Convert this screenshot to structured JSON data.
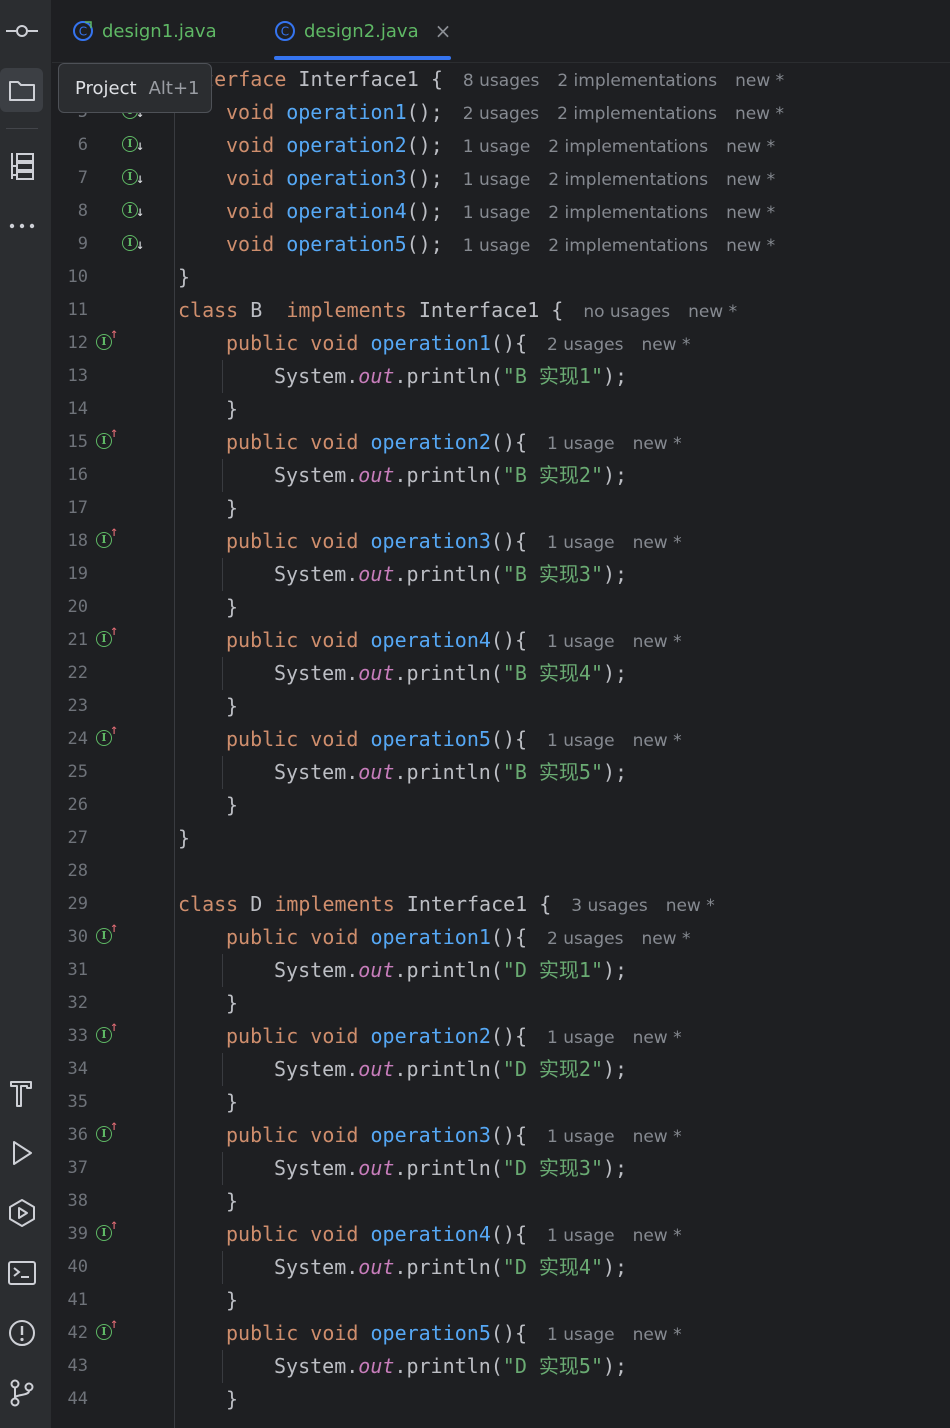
{
  "tabs": [
    {
      "label": "design1.java",
      "active": false
    },
    {
      "label": "design2.java",
      "active": true
    }
  ],
  "tooltip": {
    "label": "Project",
    "shortcut": "Alt+1"
  },
  "sidebar": {
    "top": [
      "commit-icon",
      "folder-icon",
      "structure-icon",
      "more-icon"
    ],
    "bottom": [
      "build-icon",
      "run-icon",
      "services-icon",
      "terminal-icon",
      "problems-icon",
      "git-icon"
    ]
  },
  "lines": [
    {
      "n": "",
      "gutter": "",
      "indent": 0,
      "tokens": [
        [
          "kw",
          "interface "
        ],
        [
          "plain",
          "Interface1 {"
        ]
      ],
      "hints": [
        "8 usages",
        "2 implementations",
        "new *"
      ]
    },
    {
      "n": "5",
      "gutter": "impl",
      "indent": 1,
      "tokens": [
        [
          "kw",
          "void "
        ],
        [
          "fn",
          "operation1"
        ],
        [
          "plain",
          "();"
        ]
      ],
      "hints": [
        "2 usages",
        "2 implementations",
        "new *"
      ]
    },
    {
      "n": "6",
      "gutter": "impl",
      "indent": 1,
      "tokens": [
        [
          "kw",
          "void "
        ],
        [
          "fn",
          "operation2"
        ],
        [
          "plain",
          "();"
        ]
      ],
      "hints": [
        "1 usage",
        "2 implementations",
        "new *"
      ]
    },
    {
      "n": "7",
      "gutter": "impl",
      "indent": 1,
      "tokens": [
        [
          "kw",
          "void "
        ],
        [
          "fn",
          "operation3"
        ],
        [
          "plain",
          "();"
        ]
      ],
      "hints": [
        "1 usage",
        "2 implementations",
        "new *"
      ]
    },
    {
      "n": "8",
      "gutter": "impl",
      "indent": 1,
      "tokens": [
        [
          "kw",
          "void "
        ],
        [
          "fn",
          "operation4"
        ],
        [
          "plain",
          "();"
        ]
      ],
      "hints": [
        "1 usage",
        "2 implementations",
        "new *"
      ]
    },
    {
      "n": "9",
      "gutter": "impl",
      "indent": 1,
      "tokens": [
        [
          "kw",
          "void "
        ],
        [
          "fn",
          "operation5"
        ],
        [
          "plain",
          "();"
        ]
      ],
      "hints": [
        "1 usage",
        "2 implementations",
        "new *"
      ]
    },
    {
      "n": "10",
      "gutter": "",
      "indent": 0,
      "tokens": [
        [
          "plain",
          "}"
        ]
      ],
      "hints": []
    },
    {
      "n": "11",
      "gutter": "",
      "indent": 0,
      "tokens": [
        [
          "kw",
          "class "
        ],
        [
          "plain",
          "B  "
        ],
        [
          "kw",
          "implements "
        ],
        [
          "plain",
          "Interface1 {"
        ]
      ],
      "hints": [
        "no usages",
        "new *"
      ]
    },
    {
      "n": "12",
      "gutter": "over",
      "indent": 1,
      "tokens": [
        [
          "kw",
          "public void "
        ],
        [
          "fn",
          "operation1"
        ],
        [
          "plain",
          "(){"
        ]
      ],
      "hints": [
        "2 usages",
        "new *"
      ]
    },
    {
      "n": "13",
      "gutter": "",
      "indent": 2,
      "tokens": [
        [
          "plain",
          "System."
        ],
        [
          "fld",
          "out"
        ],
        [
          "plain",
          ".println("
        ],
        [
          "str",
          "\"B 实现1\""
        ],
        [
          "plain",
          ");"
        ]
      ],
      "hints": []
    },
    {
      "n": "14",
      "gutter": "",
      "indent": 1,
      "tokens": [
        [
          "plain",
          "}"
        ]
      ],
      "hints": []
    },
    {
      "n": "15",
      "gutter": "over",
      "indent": 1,
      "tokens": [
        [
          "kw",
          "public void "
        ],
        [
          "fn",
          "operation2"
        ],
        [
          "plain",
          "(){"
        ]
      ],
      "hints": [
        "1 usage",
        "new *"
      ]
    },
    {
      "n": "16",
      "gutter": "",
      "indent": 2,
      "tokens": [
        [
          "plain",
          "System."
        ],
        [
          "fld",
          "out"
        ],
        [
          "plain",
          ".println("
        ],
        [
          "str",
          "\"B 实现2\""
        ],
        [
          "plain",
          ");"
        ]
      ],
      "hints": []
    },
    {
      "n": "17",
      "gutter": "",
      "indent": 1,
      "tokens": [
        [
          "plain",
          "}"
        ]
      ],
      "hints": []
    },
    {
      "n": "18",
      "gutter": "over",
      "indent": 1,
      "tokens": [
        [
          "kw",
          "public void "
        ],
        [
          "fn",
          "operation3"
        ],
        [
          "plain",
          "(){"
        ]
      ],
      "hints": [
        "1 usage",
        "new *"
      ]
    },
    {
      "n": "19",
      "gutter": "",
      "indent": 2,
      "tokens": [
        [
          "plain",
          "System."
        ],
        [
          "fld",
          "out"
        ],
        [
          "plain",
          ".println("
        ],
        [
          "str",
          "\"B 实现3\""
        ],
        [
          "plain",
          ");"
        ]
      ],
      "hints": []
    },
    {
      "n": "20",
      "gutter": "",
      "indent": 1,
      "tokens": [
        [
          "plain",
          "}"
        ]
      ],
      "hints": []
    },
    {
      "n": "21",
      "gutter": "over",
      "indent": 1,
      "tokens": [
        [
          "kw",
          "public void "
        ],
        [
          "fn",
          "operation4"
        ],
        [
          "plain",
          "(){"
        ]
      ],
      "hints": [
        "1 usage",
        "new *"
      ]
    },
    {
      "n": "22",
      "gutter": "",
      "indent": 2,
      "tokens": [
        [
          "plain",
          "System."
        ],
        [
          "fld",
          "out"
        ],
        [
          "plain",
          ".println("
        ],
        [
          "str",
          "\"B 实现4\""
        ],
        [
          "plain",
          ");"
        ]
      ],
      "hints": []
    },
    {
      "n": "23",
      "gutter": "",
      "indent": 1,
      "tokens": [
        [
          "plain",
          "}"
        ]
      ],
      "hints": []
    },
    {
      "n": "24",
      "gutter": "over",
      "indent": 1,
      "tokens": [
        [
          "kw",
          "public void "
        ],
        [
          "fn",
          "operation5"
        ],
        [
          "plain",
          "(){"
        ]
      ],
      "hints": [
        "1 usage",
        "new *"
      ]
    },
    {
      "n": "25",
      "gutter": "",
      "indent": 2,
      "tokens": [
        [
          "plain",
          "System."
        ],
        [
          "fld",
          "out"
        ],
        [
          "plain",
          ".println("
        ],
        [
          "str",
          "\"B 实现5\""
        ],
        [
          "plain",
          ");"
        ]
      ],
      "hints": []
    },
    {
      "n": "26",
      "gutter": "",
      "indent": 1,
      "tokens": [
        [
          "plain",
          "}"
        ]
      ],
      "hints": []
    },
    {
      "n": "27",
      "gutter": "",
      "indent": 0,
      "tokens": [
        [
          "plain",
          "}"
        ]
      ],
      "hints": []
    },
    {
      "n": "28",
      "gutter": "",
      "indent": 0,
      "tokens": [],
      "hints": []
    },
    {
      "n": "29",
      "gutter": "",
      "indent": 0,
      "tokens": [
        [
          "kw",
          "class "
        ],
        [
          "plain",
          "D "
        ],
        [
          "kw",
          "implements "
        ],
        [
          "plain",
          "Interface1 {"
        ]
      ],
      "hints": [
        "3 usages",
        "new *"
      ]
    },
    {
      "n": "30",
      "gutter": "over",
      "indent": 1,
      "tokens": [
        [
          "kw",
          "public void "
        ],
        [
          "fn",
          "operation1"
        ],
        [
          "plain",
          "(){"
        ]
      ],
      "hints": [
        "2 usages",
        "new *"
      ]
    },
    {
      "n": "31",
      "gutter": "",
      "indent": 2,
      "tokens": [
        [
          "plain",
          "System."
        ],
        [
          "fld",
          "out"
        ],
        [
          "plain",
          ".println("
        ],
        [
          "str",
          "\"D 实现1\""
        ],
        [
          "plain",
          ");"
        ]
      ],
      "hints": []
    },
    {
      "n": "32",
      "gutter": "",
      "indent": 1,
      "tokens": [
        [
          "plain",
          "}"
        ]
      ],
      "hints": []
    },
    {
      "n": "33",
      "gutter": "over",
      "indent": 1,
      "tokens": [
        [
          "kw",
          "public void "
        ],
        [
          "fn",
          "operation2"
        ],
        [
          "plain",
          "(){"
        ]
      ],
      "hints": [
        "1 usage",
        "new *"
      ]
    },
    {
      "n": "34",
      "gutter": "",
      "indent": 2,
      "tokens": [
        [
          "plain",
          "System."
        ],
        [
          "fld",
          "out"
        ],
        [
          "plain",
          ".println("
        ],
        [
          "str",
          "\"D 实现2\""
        ],
        [
          "plain",
          ");"
        ]
      ],
      "hints": []
    },
    {
      "n": "35",
      "gutter": "",
      "indent": 1,
      "tokens": [
        [
          "plain",
          "}"
        ]
      ],
      "hints": []
    },
    {
      "n": "36",
      "gutter": "over",
      "indent": 1,
      "tokens": [
        [
          "kw",
          "public void "
        ],
        [
          "fn",
          "operation3"
        ],
        [
          "plain",
          "(){"
        ]
      ],
      "hints": [
        "1 usage",
        "new *"
      ]
    },
    {
      "n": "37",
      "gutter": "",
      "indent": 2,
      "tokens": [
        [
          "plain",
          "System."
        ],
        [
          "fld",
          "out"
        ],
        [
          "plain",
          ".println("
        ],
        [
          "str",
          "\"D 实现3\""
        ],
        [
          "plain",
          ");"
        ]
      ],
      "hints": []
    },
    {
      "n": "38",
      "gutter": "",
      "indent": 1,
      "tokens": [
        [
          "plain",
          "}"
        ]
      ],
      "hints": []
    },
    {
      "n": "39",
      "gutter": "over",
      "indent": 1,
      "tokens": [
        [
          "kw",
          "public void "
        ],
        [
          "fn",
          "operation4"
        ],
        [
          "plain",
          "(){"
        ]
      ],
      "hints": [
        "1 usage",
        "new *"
      ]
    },
    {
      "n": "40",
      "gutter": "",
      "indent": 2,
      "tokens": [
        [
          "plain",
          "System."
        ],
        [
          "fld",
          "out"
        ],
        [
          "plain",
          ".println("
        ],
        [
          "str",
          "\"D 实现4\""
        ],
        [
          "plain",
          ");"
        ]
      ],
      "hints": []
    },
    {
      "n": "41",
      "gutter": "",
      "indent": 1,
      "tokens": [
        [
          "plain",
          "}"
        ]
      ],
      "hints": []
    },
    {
      "n": "42",
      "gutter": "over",
      "indent": 1,
      "tokens": [
        [
          "kw",
          "public void "
        ],
        [
          "fn",
          "operation5"
        ],
        [
          "plain",
          "(){"
        ]
      ],
      "hints": [
        "1 usage",
        "new *"
      ]
    },
    {
      "n": "43",
      "gutter": "",
      "indent": 2,
      "tokens": [
        [
          "plain",
          "System."
        ],
        [
          "fld",
          "out"
        ],
        [
          "plain",
          ".println("
        ],
        [
          "str",
          "\"D 实现5\""
        ],
        [
          "plain",
          ");"
        ]
      ],
      "hints": []
    },
    {
      "n": "44",
      "gutter": "",
      "indent": 1,
      "tokens": [
        [
          "plain",
          "}"
        ]
      ],
      "hints": []
    }
  ]
}
